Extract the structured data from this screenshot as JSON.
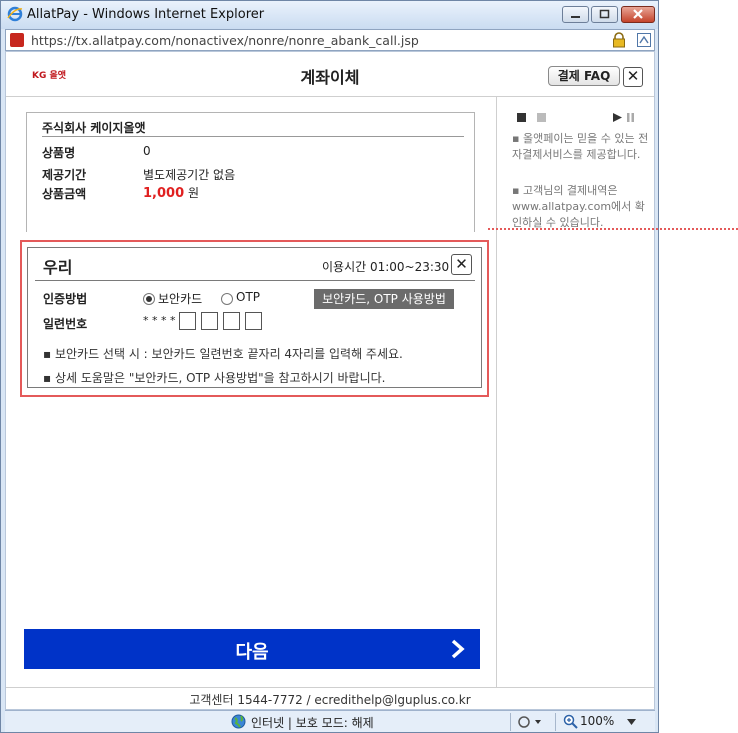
{
  "window": {
    "title": "AllatPay - Windows Internet Explorer"
  },
  "address": {
    "url": "https://tx.allatpay.com/nonactivex/nonre/nonre_abank_call.jsp"
  },
  "header": {
    "logo": "KG 올앳",
    "title": "계좌이체",
    "faq_label": "결제 FAQ",
    "close_symbol": "✕"
  },
  "order": {
    "merchant": "주식회사 케이지올앳",
    "rows": [
      {
        "label": "상품명",
        "value": "0"
      },
      {
        "label": "제공기간",
        "value": "별도제공기간 없음"
      },
      {
        "label": "상품금액",
        "amount": "1,000",
        "unit": "원"
      }
    ]
  },
  "bank": {
    "name": "우리",
    "hours": "이용시간 01:00~23:30",
    "close_symbol": "✕",
    "auth_label": "인증방법",
    "options": [
      "보안카드",
      "OTP"
    ],
    "selected": "보안카드",
    "help_button": "보안카드, OTP 사용방법",
    "serial_label": "일련번호",
    "serial_mask": "* * * *",
    "notes": [
      "보안카드 선택 시 : 보안카드 일련번호 끝자리 4자리를 입력해 주세요.",
      "상세 도움말은 \"보안카드, OTP 사용방법\"을 참고하시기 바랍니다."
    ]
  },
  "next_button": {
    "label": "다음"
  },
  "footer": {
    "text": "고객센터 1544-7772 / ecredithelp@lguplus.co.kr"
  },
  "side_info": {
    "bullets": [
      "올앳페이는 믿을 수 있는 전자결제서비스를 제공합니다.",
      "고객님의 결제내역은 www.allatpay.com에서 확인하실 수 있습니다."
    ]
  },
  "statusbar": {
    "zone": "인터넷 | 보호 모드: 해제",
    "zoom": "100%"
  },
  "colors": {
    "primary_button": "#0033c8",
    "amount": "#e02020",
    "highlight": "#e45a5a"
  }
}
